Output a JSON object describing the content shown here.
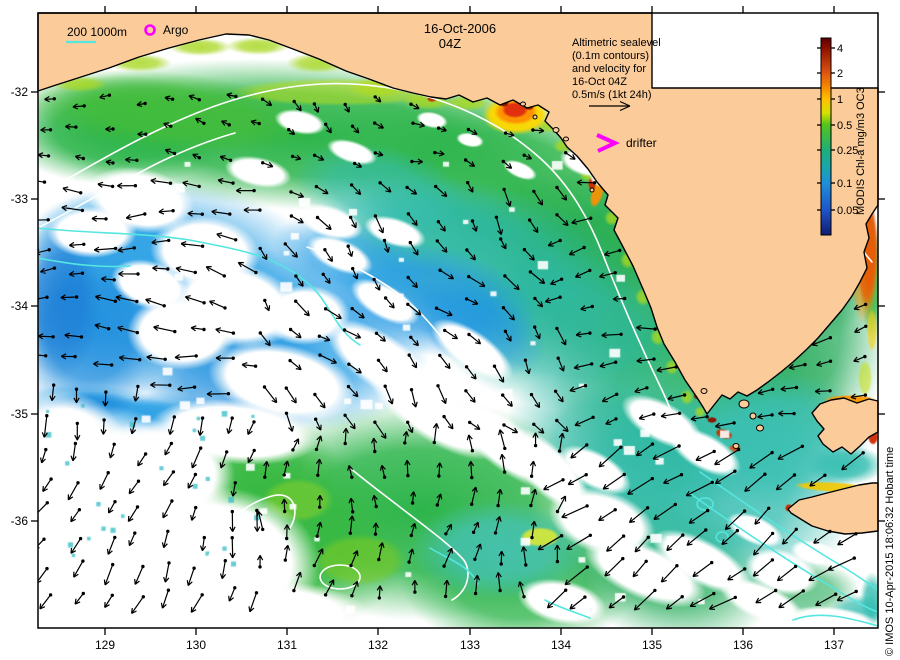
{
  "figure": {
    "title_line1": "16-Oct-2006",
    "title_line2": "04Z",
    "annotation_lines": [
      "Altimetric sealevel",
      "(0.1m contours)",
      "and velocity for",
      "16-Oct 04Z",
      "0.5m/s (1kt 24h)"
    ],
    "credit": "© IMOS 10-Apr-2015 18:06:32 Hobart time"
  },
  "markers": {
    "argo_label": "Argo",
    "drifter_label": "drifter",
    "isobath_label": "200  1000m"
  },
  "colorbar": {
    "title": "MODIS Chl-a mg/m3 OC3",
    "tick_labels": [
      "4",
      "2",
      "1",
      "0.5",
      "0.25",
      "0.1",
      "0.05"
    ]
  },
  "axes": {
    "x_tick_labels": [
      "129",
      "130",
      "131",
      "132",
      "133",
      "134",
      "135",
      "136",
      "137"
    ],
    "y_tick_labels": [
      "-32",
      "-33",
      "-34",
      "-35",
      "-36"
    ]
  },
  "colors": {
    "land": "#fbcb99",
    "coastline": "#000000",
    "magenta_marker": "#ff00ff",
    "cyan_isobath": "#55e6e0",
    "white_contour": "#ffffff",
    "vector_arrows": "#000000"
  }
}
